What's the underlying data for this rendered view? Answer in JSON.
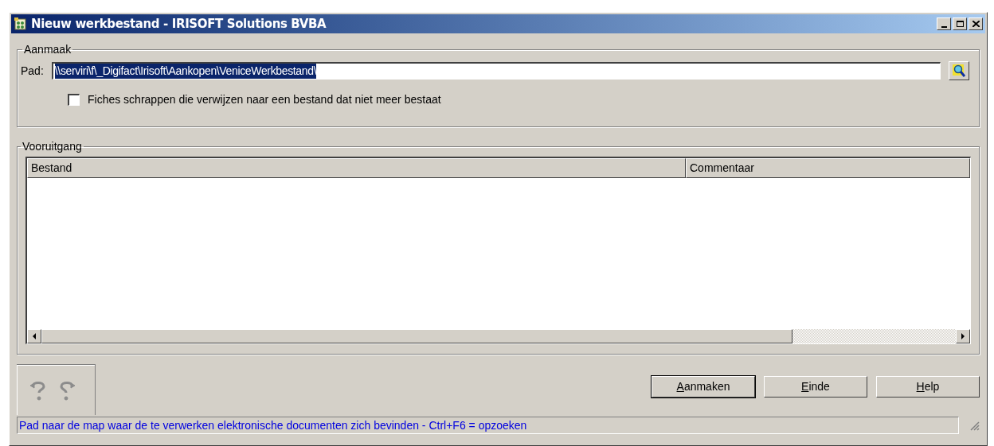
{
  "window": {
    "title": "Nieuw werkbestand - IRISOFT Solutions BVBA"
  },
  "creation": {
    "legend": "Aanmaak",
    "path_label": "Pad:",
    "path_value": "\\\\serviri\\f\\_Digifact\\Irisoft\\Aankopen\\VeniceWerkbestand\\",
    "path_text_selected": true,
    "checkbox": {
      "label": "Fiches schrappen die verwijzen naar een bestand dat niet meer bestaat",
      "checked": false
    }
  },
  "progress": {
    "legend": "Vooruitgang",
    "table": {
      "columns": [
        "Bestand",
        "Commentaar"
      ]
    }
  },
  "buttons": [
    {
      "label": "Aanmaken",
      "default": true
    },
    {
      "label": "Einde",
      "default": false
    },
    {
      "label": "Help",
      "default": false
    }
  ],
  "status_bar": "Pad naar de map waar de te verwerken elektronische documenten zich bevinden - Ctrl+F6 = opzoeken"
}
